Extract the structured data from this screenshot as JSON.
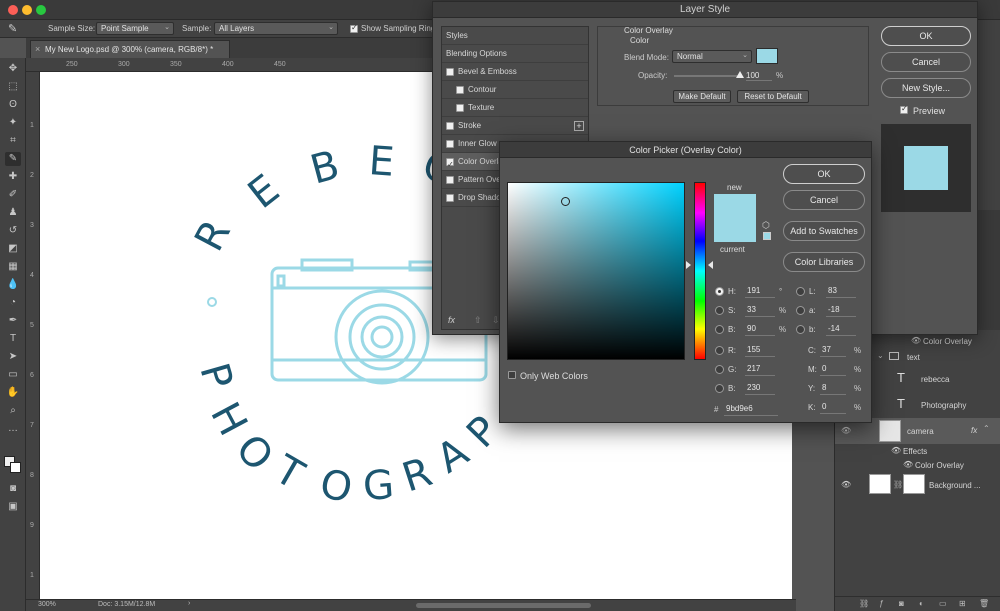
{
  "options_bar": {
    "sample_size_label": "Sample Size:",
    "sample_size_value": "Point Sample",
    "sample_label": "Sample:",
    "sample_value": "All Layers",
    "show_ring_label": "Show Sampling Ring"
  },
  "document": {
    "tab_title": "My New Logo.psd @ 300% (camera, RGB/8*) *",
    "zoom": "300%",
    "doc_size": "Doc: 3.15M/12.8M"
  },
  "rulers": {
    "h": [
      "250",
      "300",
      "350",
      "400",
      "450"
    ],
    "v": [
      "1",
      "2",
      "3",
      "4",
      "5",
      "6",
      "7",
      "8",
      "9",
      "1"
    ]
  },
  "canvas_logo": {
    "top_letters": [
      "R",
      "E",
      "B",
      "E",
      "C"
    ],
    "bottom_letters": [
      "P",
      "H",
      "O",
      "T",
      "O",
      "G",
      "R",
      "A",
      "P"
    ]
  },
  "layer_style": {
    "title": "Layer Style",
    "styles_header": "Styles",
    "items": [
      {
        "label": "Blending Options",
        "checkbox": false,
        "checked": false,
        "indent": false
      },
      {
        "label": "Bevel & Emboss",
        "checkbox": true,
        "checked": false,
        "indent": false
      },
      {
        "label": "Contour",
        "checkbox": true,
        "checked": false,
        "indent": true
      },
      {
        "label": "Texture",
        "checkbox": true,
        "checked": false,
        "indent": true
      },
      {
        "label": "Stroke",
        "checkbox": true,
        "checked": false,
        "indent": false
      },
      {
        "label": "Inner Glow",
        "checkbox": true,
        "checked": false,
        "indent": false
      },
      {
        "label": "Color Overlay",
        "checkbox": true,
        "checked": true,
        "indent": false
      },
      {
        "label": "Pattern Overla",
        "checkbox": true,
        "checked": false,
        "indent": false
      },
      {
        "label": "Drop Shadow",
        "checkbox": true,
        "checked": false,
        "indent": false
      }
    ],
    "section_title": "Color Overlay",
    "sub_title": "Color",
    "blend_mode_label": "Blend Mode:",
    "blend_mode_value": "Normal",
    "opacity_label": "Opacity:",
    "opacity_value": "100",
    "opacity_unit": "%",
    "opacity_level": 1.0,
    "make_default": "Make Default",
    "reset_default": "Reset to Default",
    "ok": "OK",
    "cancel": "Cancel",
    "new_style": "New Style...",
    "preview": "Preview",
    "fx_label": "fx",
    "overlay_color": "#9bd9e6"
  },
  "color_picker": {
    "title": "Color Picker (Overlay Color)",
    "new_label": "new",
    "current_label": "current",
    "ok": "OK",
    "cancel": "Cancel",
    "add_swatches": "Add to Swatches",
    "color_libraries": "Color Libraries",
    "only_web": "Only Web Colors",
    "hsb": [
      {
        "label": "H:",
        "value": "191",
        "unit": "°",
        "selected": true
      },
      {
        "label": "S:",
        "value": "33",
        "unit": "%",
        "selected": false
      },
      {
        "label": "B:",
        "value": "90",
        "unit": "%",
        "selected": false
      }
    ],
    "rgb": [
      {
        "label": "R:",
        "value": "155"
      },
      {
        "label": "G:",
        "value": "217"
      },
      {
        "label": "B:",
        "value": "230"
      }
    ],
    "lab": [
      {
        "label": "L:",
        "value": "83"
      },
      {
        "label": "a:",
        "value": "-18"
      },
      {
        "label": "b:",
        "value": "-14"
      }
    ],
    "cmyk": [
      {
        "label": "C:",
        "value": "37",
        "unit": "%"
      },
      {
        "label": "M:",
        "value": "0",
        "unit": "%"
      },
      {
        "label": "Y:",
        "value": "8",
        "unit": "%"
      },
      {
        "label": "K:",
        "value": "0",
        "unit": "%"
      }
    ],
    "hex_label": "#",
    "hex": "9bd9e6",
    "new_color": "#9bd9e6",
    "current_color": "#9bd9e6",
    "hue_color": "#00d2ff"
  },
  "layers": {
    "rows": [
      {
        "label": "Color Overlay",
        "kind": "effect"
      },
      {
        "label": "text",
        "kind": "group"
      },
      {
        "label": "rebecca",
        "kind": "text"
      },
      {
        "label": "Photography",
        "kind": "text"
      },
      {
        "label": "camera",
        "kind": "layer"
      },
      {
        "label": "Effects",
        "kind": "effects"
      },
      {
        "label": "Color Overlay",
        "kind": "effect"
      },
      {
        "label": "Background ...",
        "kind": "layer"
      }
    ],
    "fx": "fx"
  }
}
